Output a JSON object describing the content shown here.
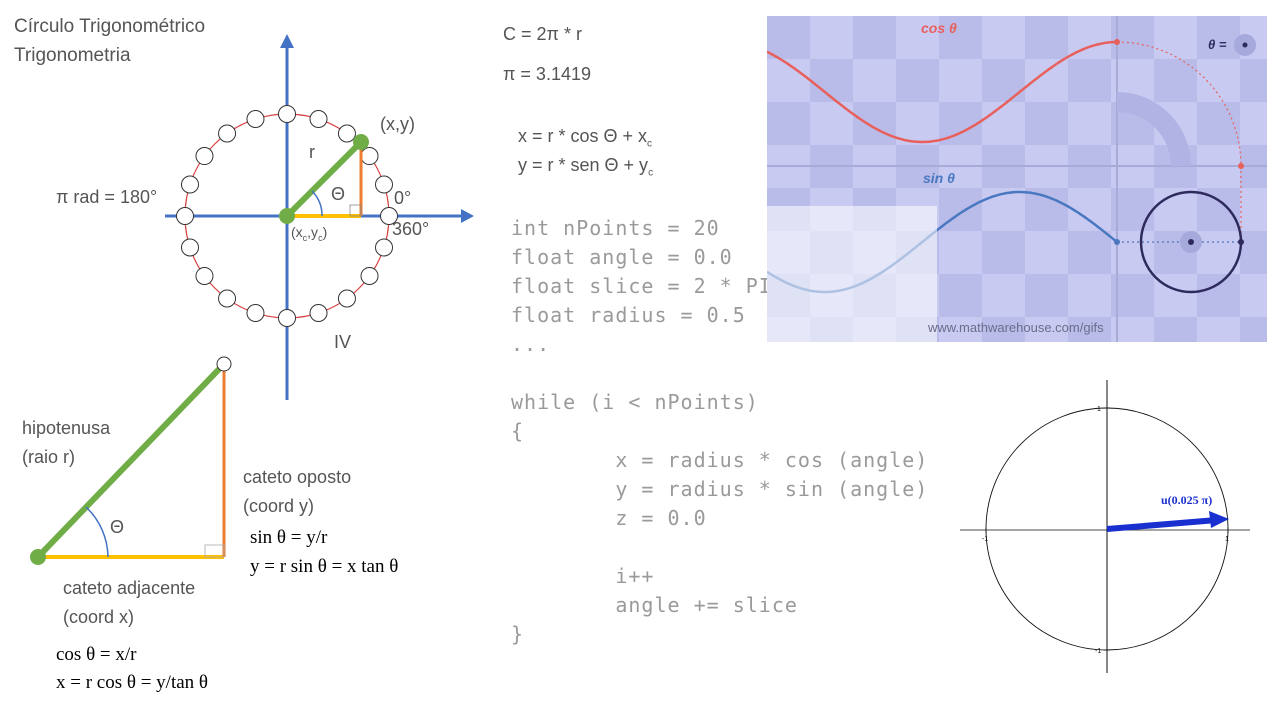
{
  "title": {
    "line1": "Círculo Trigonométrico",
    "line2": "Trigonometria"
  },
  "unit_circle": {
    "label_r": "r",
    "label_xy": "(x,y)",
    "label_theta": "Θ",
    "label_zero": "0°",
    "label_360": "360°",
    "label_pi": "π rad = 180°",
    "label_center": "(x",
    "label_center_sub1": "c",
    "label_center_mid": ",y",
    "label_center_sub2": "c",
    "label_center_end": ")",
    "label_quadrant": "IV",
    "points_count": 20,
    "colors": {
      "axis": "#4472c4",
      "circle": "#d94040",
      "radius": "#70ad47",
      "adjacent": "#ffc000",
      "opposite": "#ed7d31"
    }
  },
  "triangle": {
    "hyp_line1": "hipotenusa",
    "hyp_line2": "(raio r)",
    "opp_line1": "cateto oposto",
    "opp_line2": "(coord y)",
    "adj_line1": "cateto adjacente",
    "adj_line2": "(coord x)",
    "theta": "Θ",
    "sin1": "sin θ = y/r",
    "sin2": "y = r sin θ = x tan θ",
    "cos1": "cos θ = x/r",
    "cos2": "x = r cos θ = y/tan θ"
  },
  "formulas": {
    "circ": "C = 2π * r",
    "pi": "π = 3.1419",
    "x_pre": "x = r * cos Θ + x",
    "x_sub": "c",
    "y_pre": "y = r * sen Θ + y",
    "y_sub": "c"
  },
  "code": {
    "lines": [
      "int nPoints = 20",
      "float angle = 0.0",
      "float slice = 2 * PI / nPoints",
      "float radius = 0.5",
      "...",
      "",
      "while (i < nPoints)",
      "{",
      "        x = radius * cos (angle)",
      "        y = radius * sin (angle)",
      "        z = 0.0",
      "",
      "        i++",
      "        angle += slice",
      "}"
    ]
  },
  "animation_panel": {
    "cos_label": "cos θ",
    "sin_label": "sin θ",
    "theta_label": "θ =",
    "credit": "www.mathwarehouse.com/gifs",
    "colors": {
      "bg": "#c8caf2",
      "check": "#b8bbea",
      "cos": "#e8605c",
      "sin": "#4a78c0",
      "circle": "#2e2a5c"
    }
  },
  "vector_plot": {
    "label": "u(0.025 π)",
    "tick_neg": "-1",
    "tick_pos": "1",
    "colors": {
      "vector": "#1a2fd0"
    }
  }
}
